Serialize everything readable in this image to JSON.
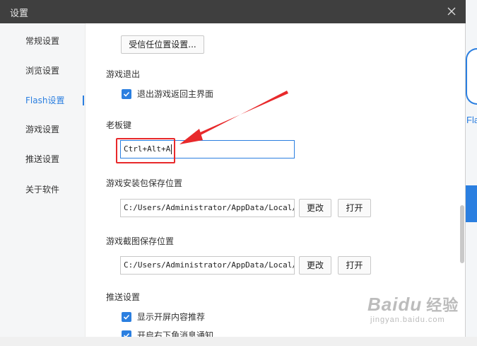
{
  "window": {
    "title": "设置"
  },
  "sidebar": {
    "items": [
      {
        "label": "常规设置",
        "active": false
      },
      {
        "label": "浏览设置",
        "active": false
      },
      {
        "label": "Flash设置",
        "active": true
      },
      {
        "label": "游戏设置",
        "active": false
      },
      {
        "label": "推送设置",
        "active": false
      },
      {
        "label": "关于软件",
        "active": false
      }
    ]
  },
  "content": {
    "trusted_button": "受信任位置设置...",
    "game_exit": {
      "title": "游戏退出",
      "checkbox_label": "退出游戏返回主界面",
      "checked": true
    },
    "boss_key": {
      "title": "老板键",
      "value": "Ctrl+Alt+A"
    },
    "install_path": {
      "title": "游戏安装包保存位置",
      "value": "C:/Users/Administrator/AppData/Local/Flash",
      "change_button": "更改",
      "open_button": "打开"
    },
    "screenshot_path": {
      "title": "游戏截图保存位置",
      "value": "C:/Users/Administrator/AppData/Local/Flash",
      "change_button": "更改",
      "open_button": "打开"
    },
    "push": {
      "title": "推送设置",
      "options": [
        {
          "label": "显示开屏内容推荐",
          "checked": true
        },
        {
          "label": "开启右下角消息通知",
          "checked": true
        }
      ]
    }
  },
  "background": {
    "partial_label": "Fla"
  },
  "watermark": {
    "logo": "Baidu",
    "logo_cn": "经验",
    "url": "jingyan.baidu.com"
  },
  "colors": {
    "accent": "#2b7fe0",
    "annotation": "#e8292b",
    "titlebar": "#3f3f3f"
  }
}
